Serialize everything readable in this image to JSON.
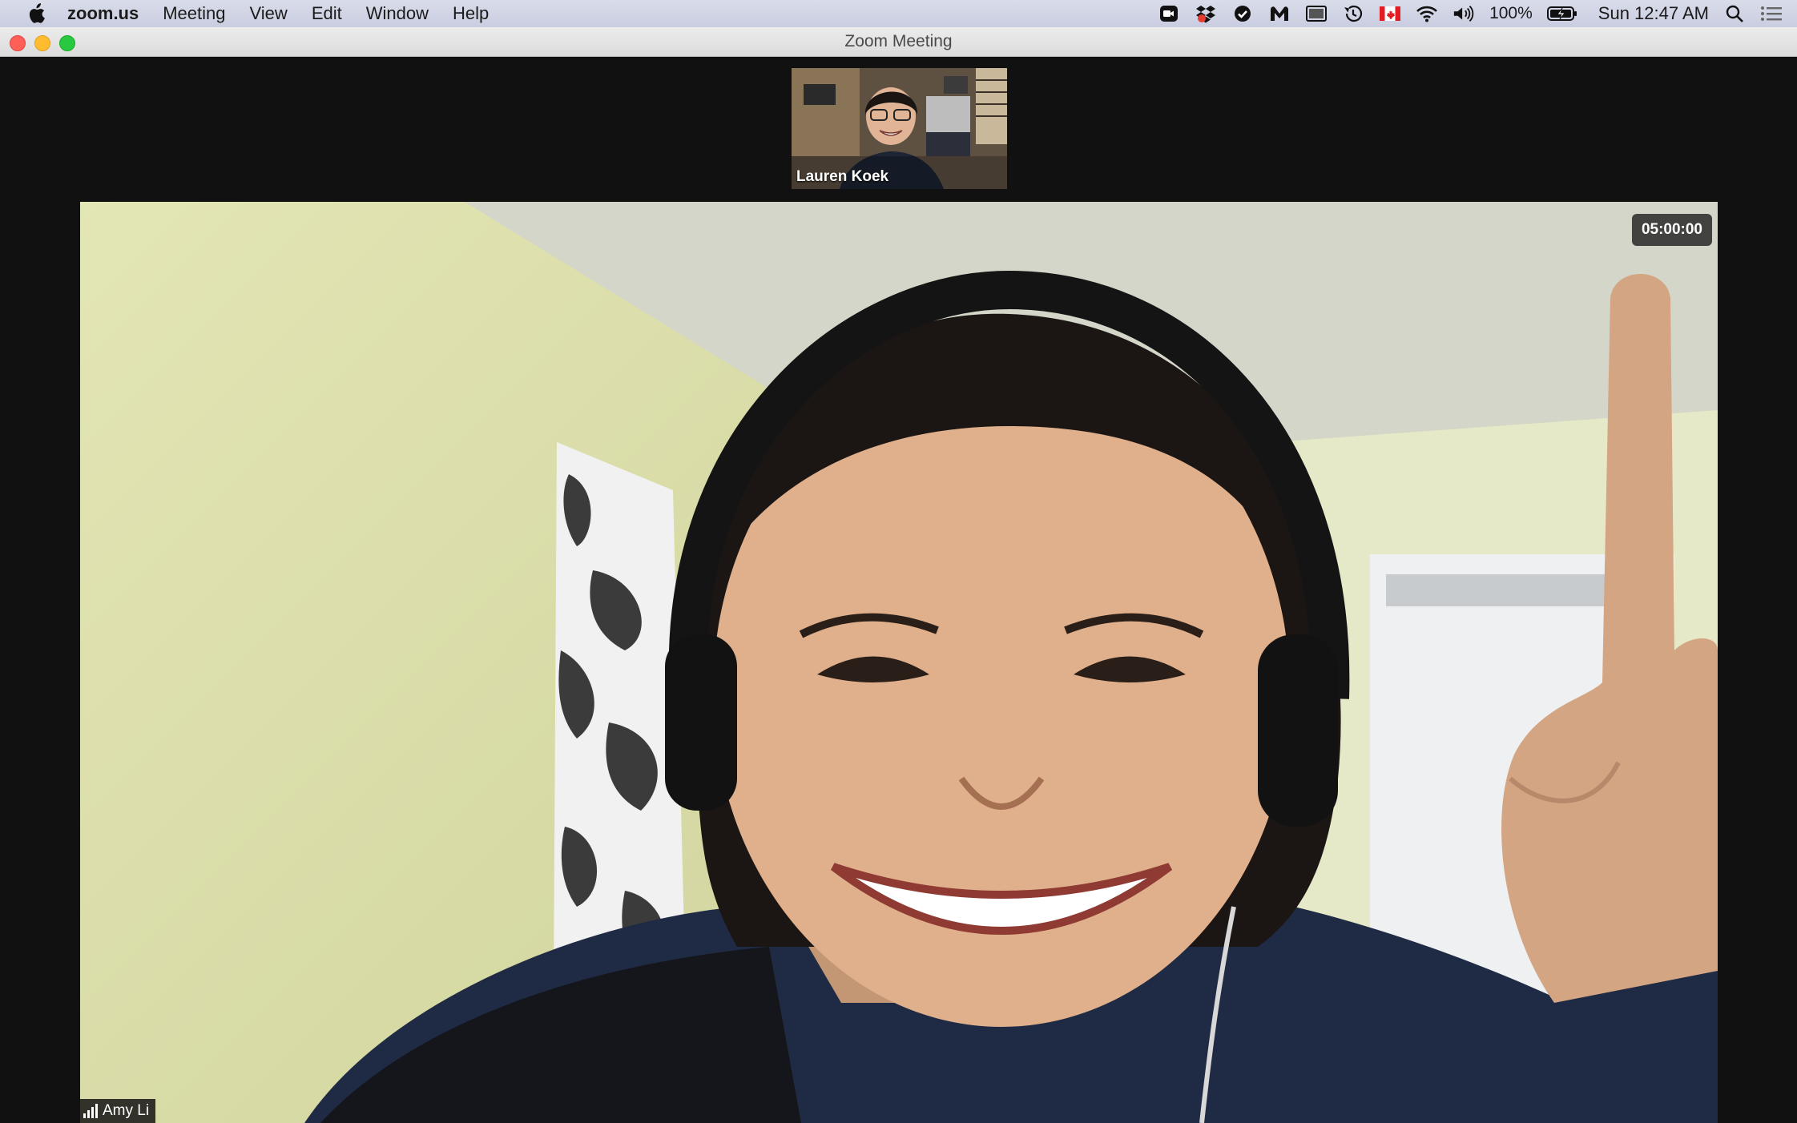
{
  "menubar": {
    "apple_icon": "apple-logo-icon",
    "items": [
      "zoom.us",
      "Meeting",
      "View",
      "Edit",
      "Window",
      "Help"
    ],
    "status": {
      "icons": [
        "zoom-camera-icon",
        "dropbox-icon",
        "checkmark-icon",
        "malwarebytes-icon",
        "screen-icon",
        "time-machine-icon",
        "canada-flag-icon",
        "wifi-icon",
        "volume-icon"
      ],
      "battery_text": "100%",
      "battery_icon": "battery-charging-icon",
      "clock": "Sun 12:47 AM",
      "search_icon": "spotlight-search-icon",
      "notification_icon": "notification-center-icon"
    }
  },
  "window": {
    "title": "Zoom Meeting"
  },
  "meeting": {
    "thumbnail": {
      "name": "Lauren Koek"
    },
    "main": {
      "name": "Amy Li",
      "timer": "05:00:00"
    }
  },
  "colors": {
    "background": "#111111",
    "wall": "#dfe2af",
    "close": "#fe5f57",
    "minimize": "#febc2e",
    "maximize": "#28c840"
  }
}
